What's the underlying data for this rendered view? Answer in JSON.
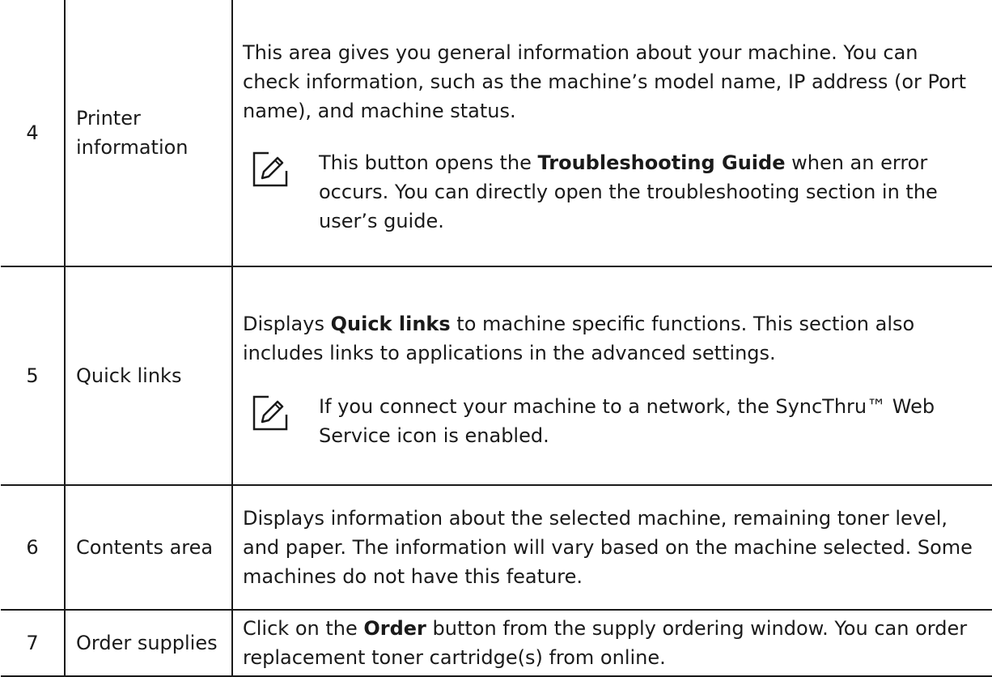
{
  "rows": [
    {
      "number": "4",
      "name": "Printer information",
      "description": "This area gives you general information about your machine. You can check information, such as the machine’s model name, IP address (or Port name), and machine status.",
      "note": {
        "before": "This button opens the ",
        "bold": "Troubleshooting Guide",
        "after": " when an error occurs. You can directly open the troubleshooting section in the user’s guide."
      }
    },
    {
      "number": "5",
      "name": "Quick links",
      "description": {
        "before": "Displays ",
        "bold": "Quick links",
        "after": " to machine specific functions. This section also includes links to applications in the advanced settings."
      },
      "note": {
        "text": "If you connect your machine to a network, the SyncThru™ Web Service icon is enabled."
      }
    },
    {
      "number": "6",
      "name": "Contents area",
      "description": "Displays information about the selected machine, remaining toner level, and paper. The information will vary based on the machine selected. Some machines do not have this feature."
    },
    {
      "number": "7",
      "name": "Order supplies",
      "description": {
        "before": "Click on the ",
        "bold": "Order",
        "after": " button from the supply ordering window. You can order replacement toner cartridge(s) from online."
      }
    }
  ],
  "icons": {
    "note": "note-pencil-icon"
  }
}
